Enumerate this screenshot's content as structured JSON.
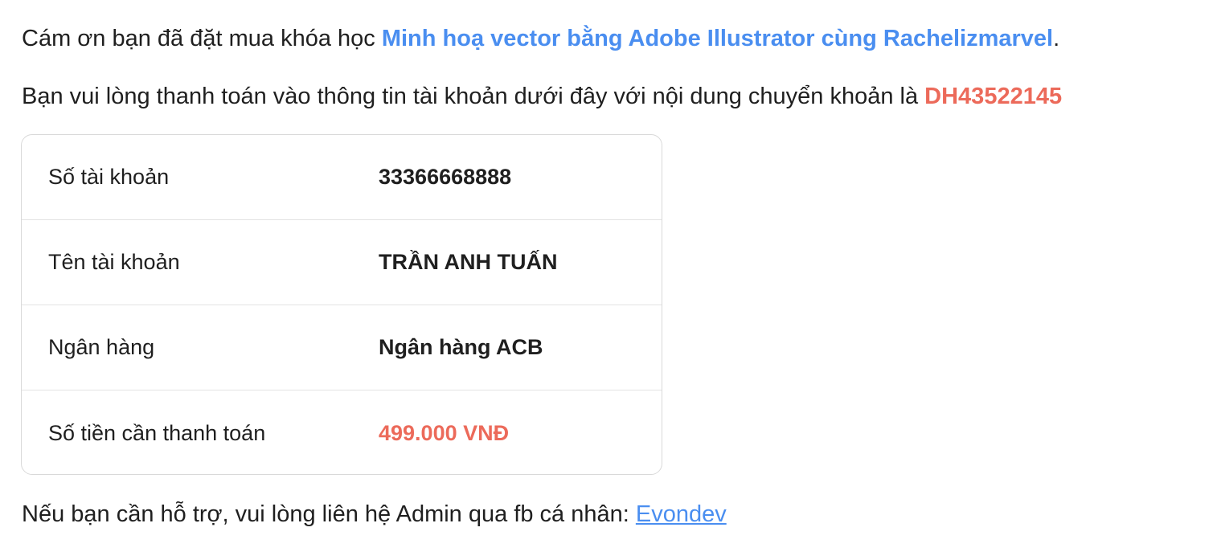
{
  "intro": {
    "prefix": "Cám ơn bạn đã đặt mua khóa học ",
    "course_title": "Minh hoạ vector bằng Adobe Illustrator cùng Rachelizmarvel",
    "suffix": "."
  },
  "instruction": {
    "text": "Bạn vui lòng thanh toán vào thông tin tài khoản dưới đây với nội dung chuyển khoản là ",
    "order_code": "DH43522145"
  },
  "payment": {
    "rows": [
      {
        "label": "Số tài khoản",
        "value": "33366668888"
      },
      {
        "label": "Tên tài khoản",
        "value": "TRẦN ANH TUẤN"
      },
      {
        "label": "Ngân hàng",
        "value": "Ngân hàng ACB"
      },
      {
        "label": "Số tiền cần thanh toán",
        "value": "499.000 VNĐ"
      }
    ]
  },
  "support": {
    "text": "Nếu bạn cần hỗ trợ, vui lòng liên hệ Admin qua fb cá nhân: ",
    "admin_link": "Evondev"
  },
  "colors": {
    "link": "#4a8ef0",
    "highlight": "#ec6a5a",
    "text": "#1f1f1f",
    "border": "#d9d9d9"
  }
}
